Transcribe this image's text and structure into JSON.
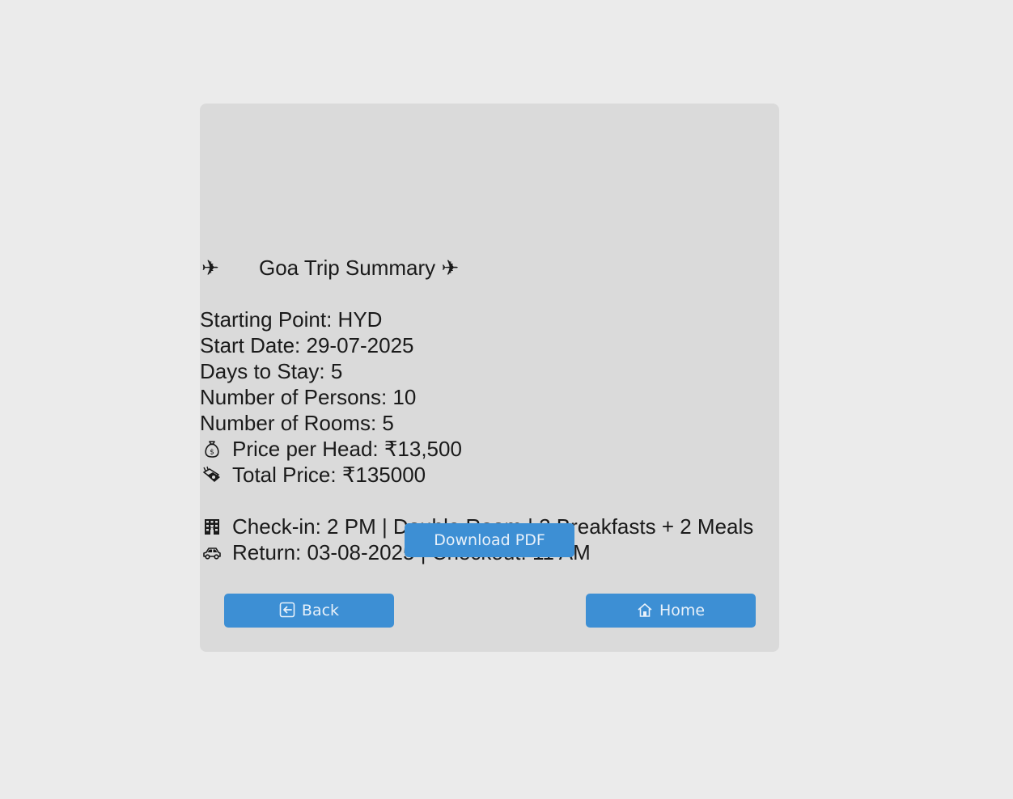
{
  "summary": {
    "plane_glyph": "✈",
    "title": "Goa Trip Summary ✈",
    "starting_point": "Starting Point: HYD",
    "start_date": "Start Date: 29-07-2025",
    "days_to_stay": "Days to Stay: 5",
    "persons": "Number of Persons: 10",
    "rooms": "Number of Rooms: 5",
    "price_per_head": "Price per Head: ₹13,500",
    "total_price": "Total Price: ₹135000",
    "checkin": "Check-in: 2 PM | Double Room | 2 Breakfasts + 2 Meals",
    "return": "Return: 03-08-2025 | Checkout: 11 AM",
    "icons": {
      "price_per_head": "money-bag-icon",
      "total_price": "money-wings-icon",
      "checkin": "hotel-icon",
      "return": "car-icon"
    }
  },
  "buttons": {
    "download_pdf": "Download PDF",
    "back": "Back",
    "home": "Home"
  },
  "colors": {
    "page_background": "#ebebeb",
    "card_background": "#dadada",
    "button_background": "#3d8fd4",
    "button_text": "#e8f1fa",
    "text": "#1a1a1a"
  }
}
